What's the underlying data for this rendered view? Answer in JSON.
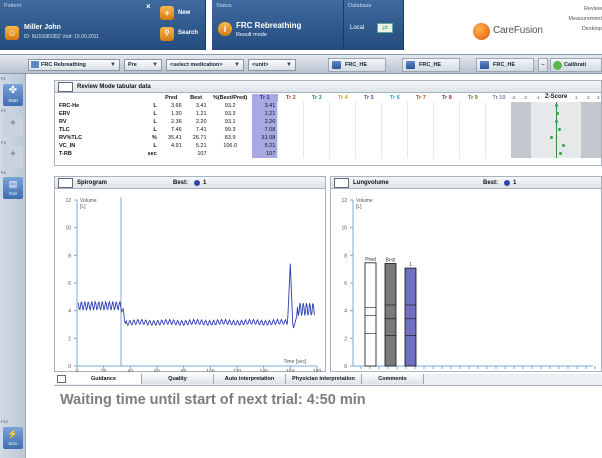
{
  "header": {
    "patient_label": "Patient",
    "patient_name": "Miller John",
    "patient_id": "ID: MJ15081952 Visit: 15.09.2011",
    "new_label": "New",
    "search_label": "Search",
    "status_label": "Status",
    "status_title": "FRC Rebreathing",
    "status_mode": "Result mode",
    "database_label": "Database",
    "database_value": "Local",
    "brand": "CareFusion",
    "right_lines": [
      "Review",
      "Measurement",
      "Desktop"
    ]
  },
  "toolbar": {
    "test_select": "FRC Rebreathing",
    "phase_select": "Pre",
    "medication_select": "<select medication>",
    "unit_select": "<unit>",
    "buttons": [
      "FRC_HE",
      "FRC_HE",
      "FRC_HE"
    ],
    "calibration": "Calibrati"
  },
  "rail": {
    "items": [
      {
        "key": "F1",
        "label": "Start"
      },
      {
        "key": "F2",
        "label": ""
      },
      {
        "key": "F3",
        "label": ""
      },
      {
        "key": "F4",
        "label": "Exit"
      },
      {
        "key": "F12",
        "label": "Zero"
      }
    ]
  },
  "table": {
    "title": "Review Mode tabular data",
    "columns": [
      "Pred",
      "Best",
      "%(Best/Pred)",
      "Tr 1",
      "Tr 2",
      "Tr 3",
      "Tr 4",
      "Tr 5",
      "Tr 6",
      "Tr 7",
      "Tr 8",
      "Tr 9",
      "Tr 10"
    ],
    "trial_colors": [
      "#2b2b9a",
      "#c0392b",
      "#2e8b57",
      "#d4a017",
      "#6a3fa0",
      "#30a0c0",
      "#b05020",
      "#a02070",
      "#508020",
      "#7080a0"
    ],
    "zscore_label": "Z-Score",
    "zscore_ticks": [
      "-3",
      "-2",
      "-1",
      "0",
      "1",
      "2",
      "3"
    ],
    "rows": [
      {
        "name": "FRC-He",
        "unit": "L",
        "pred": "3.66",
        "best": "3.41",
        "pct": "93.2",
        "tr1": "3.41",
        "z": 0.0
      },
      {
        "name": "ERV",
        "unit": "L",
        "pred": "1.30",
        "best": "1.21",
        "pct": "93.3",
        "tr1": "1.21",
        "z": 0.1
      },
      {
        "name": "RV",
        "unit": "L",
        "pred": "2.36",
        "best": "2.20",
        "pct": "93.1",
        "tr1": "2.20",
        "z": 0.0
      },
      {
        "name": "TLC",
        "unit": "L",
        "pred": "7.46",
        "best": "7.41",
        "pct": "99.3",
        "tr1": "7.08",
        "z": 0.3
      },
      {
        "name": "RV%TLC",
        "unit": "%",
        "pred": "35.41",
        "best": "26.71",
        "pct": "83.9",
        "tr1": "31.08",
        "z": -0.4
      },
      {
        "name": "VC_IN",
        "unit": "L",
        "pred": "4.91",
        "best": "5.21",
        "pct": "106.0",
        "tr1": "5.21",
        "z": 0.6
      },
      {
        "name": "T-RB",
        "unit": "sec",
        "pred": "",
        "best": "107",
        "pct": "",
        "tr1": "107",
        "z": 0.4
      }
    ]
  },
  "spirogram": {
    "title": "Spirogram",
    "best_label": "Best:",
    "best_value": "1",
    "ylabel": "Volume\n[L]",
    "xlabel": "Time [sec]",
    "yticks": [
      "0",
      "2",
      "4",
      "6",
      "8",
      "10",
      "12"
    ],
    "xticks": [
      "0",
      "20",
      "40",
      "60",
      "80",
      "100",
      "120",
      "140",
      "160",
      "180"
    ],
    "xlim": [
      0,
      180
    ],
    "ylim": [
      0,
      12
    ],
    "marker_time": 33
  },
  "lungvolume": {
    "title": "Lungvolume",
    "best_label": "Best:",
    "best_value": "1",
    "ylabel": "Volume\n[L]",
    "yticks": [
      "0",
      "2",
      "4",
      "6",
      "8",
      "10",
      "12"
    ],
    "ylim": [
      0,
      12
    ],
    "bars": [
      {
        "label": "Pred",
        "top": 7.46,
        "lines": [
          4.22,
          3.66,
          2.36
        ],
        "color": "#ffffff"
      },
      {
        "label": "Best",
        "top": 7.41,
        "lines": [
          4.41,
          3.41,
          2.2
        ],
        "color": "#7a7a7a"
      },
      {
        "label": "1",
        "top": 7.08,
        "lines": [
          4.41,
          3.41,
          2.2
        ],
        "color": "#6f6fc4"
      }
    ]
  },
  "bottom": {
    "tabs": [
      "Guidance",
      "Quality",
      "Auto interpretation",
      "Physician interpretation",
      "Comments"
    ],
    "message": "Waiting time until start of next trial: 4:50 min"
  },
  "colors": {
    "accent": "#2a4f84",
    "brand_orange": "#e8701a",
    "trial1": "#a8a9e3"
  }
}
